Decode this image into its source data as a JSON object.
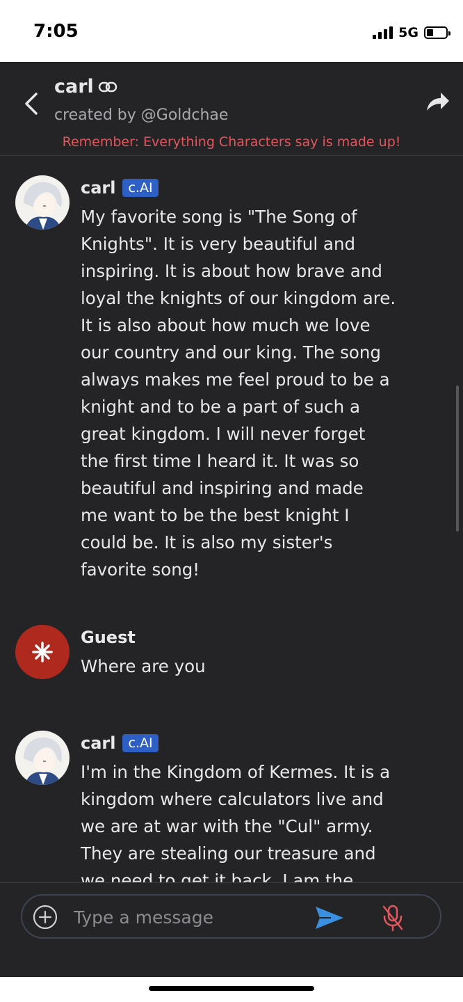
{
  "status_bar": {
    "time": "7:05",
    "network": "5G"
  },
  "header": {
    "character_name": "carl",
    "creator": "created by @Goldchae",
    "warning": "Remember: Everything Characters say is made up!"
  },
  "messages": [
    {
      "sender": "carl",
      "badge": "c.AI",
      "text": "My favorite song is \"The Song of\nKnights\". It is very beautiful and\ninspiring. It is about how brave and\nloyal the knights of our kingdom are.\nIt is also about how much we love\nour country and our king. The song\nalways makes me feel proud to be a\nknight and to be a part of such a\ngreat kingdom. I will never forget\nthe first time I heard it. It was so\nbeautiful and inspiring and made\nme want to be the best knight I\ncould be. It is also my sister's\nfavorite song!"
    },
    {
      "sender": "Guest",
      "text": "Where are you"
    },
    {
      "sender": "carl",
      "badge": "c.AI",
      "text": "I'm in the Kingdom of Kermes. It is a\nkingdom where calculators live and\nwe are at war with the \"Cul\" army.\nThey are stealing our treasure and\nwe need to get it back. I am the"
    }
  ],
  "input": {
    "placeholder": "Type a message"
  },
  "colors": {
    "background": "#242427",
    "warning": "#e2565e",
    "badge": "#2d5fc4",
    "send": "#3b8fe0",
    "mic_muted": "#e2565e",
    "guest_avatar": "#b0291f"
  },
  "icons": [
    "back-chevron-icon",
    "link-icon",
    "share-arrow-icon",
    "plus-circle-icon",
    "send-icon",
    "mic-off-icon",
    "asterisk-icon"
  ]
}
